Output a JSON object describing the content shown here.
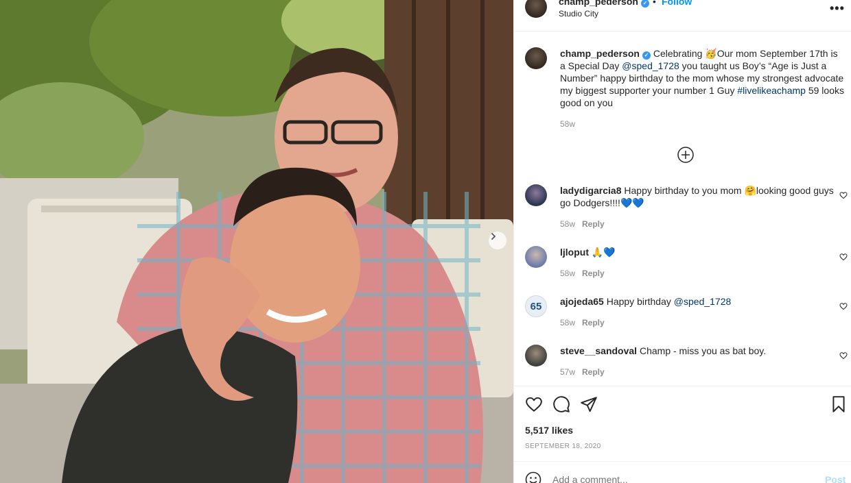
{
  "post": {
    "header": {
      "username": "champ_pederson",
      "separator": "•",
      "follow_label": "Follow",
      "location": "Studio City",
      "more_label": "•••"
    },
    "caption": {
      "username": "champ_pederson",
      "text_1": "Celebrating 🥳Our mom September 17th is a Special Day ",
      "mention": "@sped_1728",
      "text_2": " you taught us Boy’s “Age is Just a Number” happy birthday to the mom whose my strongest advocate my biggest supporter your number 1 Guy ",
      "hashtag": "#livelikeachamp",
      "text_3": " 59 looks good on you",
      "time": "58w"
    },
    "comments": [
      {
        "username": "ladydigarcia8",
        "text": " Happy birthday to you mom 🤗looking good guys go Dodgers!!!!💙💙",
        "time": "58w",
        "reply_label": "Reply",
        "avatar_color": "#2a3550"
      },
      {
        "username": "ljloput",
        "text": " 🙏💙",
        "time": "58w",
        "reply_label": "Reply",
        "avatar_color": "#6a7aa8"
      },
      {
        "username": "ajojeda65",
        "text": " Happy birthday ",
        "mention": "@sped_1728",
        "time": "58w",
        "reply_label": "Reply",
        "avatar_text": "65",
        "avatar_color": "#e8eef6"
      },
      {
        "username": "steve__sandoval",
        "text": " Champ - miss you as bat boy.",
        "time": "57w",
        "reply_label": "Reply",
        "avatar_color": "#3b3f3c"
      }
    ],
    "likes": "5,517 likes",
    "date": "SEPTEMBER 18, 2020",
    "add_comment": {
      "placeholder": "Add a comment...",
      "post_label": "Post"
    },
    "icons": {
      "like": "heart-icon",
      "comment": "comment-bubble-icon",
      "share": "paper-plane-icon",
      "save": "bookmark-icon",
      "emoji": "emoji-icon",
      "load_more": "plus-circle-icon",
      "next": "chevron-right-icon"
    },
    "colors": {
      "link": "#00376b",
      "follow": "#0095f6",
      "verified": "#3897f0",
      "muted": "#8e8e8e",
      "post_disabled": "#b2dffc"
    }
  }
}
